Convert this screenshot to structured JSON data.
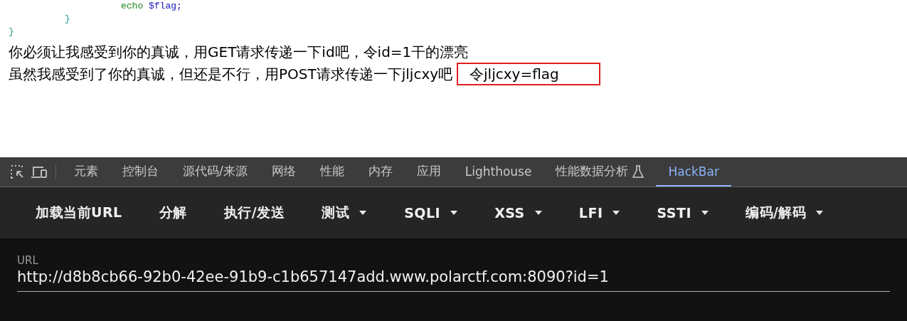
{
  "code_lines": [
    {
      "children": [
        {
          "children": [
            {
              "tokens": [
                {
                  "kind": "keyword",
                  "text": "echo"
                },
                {
                  "kind": "variable",
                  "text": " $flag"
                },
                {
                  "kind": "punct",
                  "text": ";"
                }
              ]
            }
          ],
          "tokens": [
            {
              "kind": "brace",
              "text": "}"
            }
          ]
        }
      ],
      "tokens": [
        {
          "kind": "brace",
          "text": "}"
        }
      ]
    }
  ],
  "messages": [
    {
      "text": "你必须让我感受到你的真诚，用GET请求传递一下id吧，令id=1干的漂亮"
    },
    {
      "text": "虽然我感受到了你的真诚，但还是不行，用POST请求传递一下jljcxy吧",
      "highlight": "令jljcxy=flag"
    }
  ],
  "devtools": {
    "tabs": [
      {
        "label": "元素",
        "selected": false
      },
      {
        "label": "控制台",
        "selected": false
      },
      {
        "label": "源代码/来源",
        "selected": false
      },
      {
        "label": "网络",
        "selected": false
      },
      {
        "label": "性能",
        "selected": false
      },
      {
        "label": "内存",
        "selected": false
      },
      {
        "label": "应用",
        "selected": false
      },
      {
        "label": "Lighthouse",
        "selected": false
      },
      {
        "label": "性能数据分析",
        "selected": false,
        "experimental": true
      },
      {
        "label": "HackBar",
        "selected": true
      }
    ],
    "hackbar_buttons": [
      {
        "label": "加载当前URL",
        "dropdown": false
      },
      {
        "label": "分解",
        "dropdown": false
      },
      {
        "label": "执行/发送",
        "dropdown": false
      },
      {
        "label": "测试",
        "dropdown": true
      },
      {
        "label": "SQLI",
        "dropdown": true
      },
      {
        "label": "XSS",
        "dropdown": true
      },
      {
        "label": "LFI",
        "dropdown": true
      },
      {
        "label": "SSTI",
        "dropdown": true
      },
      {
        "label": "编码/解码",
        "dropdown": true
      }
    ],
    "url_field": {
      "label": "URL",
      "value": "http://d8b8cb66-92b0-42ee-91b9-c1b657147add.www.polarctf.com:8090?id=1"
    }
  }
}
